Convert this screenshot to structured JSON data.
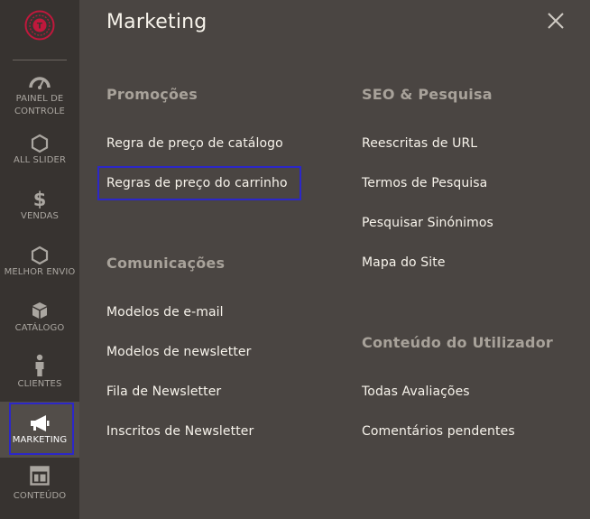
{
  "sidebar": {
    "items": [
      {
        "label_line1": "PAINEL DE",
        "label_line2": "CONTROLE",
        "icon": "dashboard-icon"
      },
      {
        "label": "ALL SLIDER",
        "icon": "hexagon-icon"
      },
      {
        "label": "VENDAS",
        "icon": "dollar-icon"
      },
      {
        "label": "MELHOR ENVIO",
        "icon": "hexagon-icon"
      },
      {
        "label": "CATÁLOGO",
        "icon": "box-icon"
      },
      {
        "label": "CLIENTES",
        "icon": "person-icon"
      },
      {
        "label": "MARKETING",
        "icon": "megaphone-icon",
        "active": true
      },
      {
        "label": "CONTEÚDO",
        "icon": "layout-icon"
      }
    ]
  },
  "panel": {
    "title": "Marketing",
    "columns": [
      {
        "sections": [
          {
            "title": "Promoções",
            "links": [
              "Regra de preço de catálogo",
              "Regras de preço do carrinho"
            ]
          },
          {
            "title": "Comunicações",
            "links": [
              "Modelos de e-mail",
              "Modelos de newsletter",
              "Fila de Newsletter",
              "Inscritos de Newsletter"
            ]
          }
        ]
      },
      {
        "sections": [
          {
            "title": "SEO & Pesquisa",
            "links": [
              "Reescritas de URL",
              "Termos de Pesquisa",
              "Pesquisar Sinónimos",
              "Mapa do Site"
            ]
          },
          {
            "title": "Conteúdo do Utilizador",
            "links": [
              "Todas Avaliações",
              "Comentários pendentes"
            ]
          }
        ]
      }
    ]
  },
  "colors": {
    "sidebar_bg": "#373330",
    "panel_bg": "#4a4542",
    "active_bg": "#524d49",
    "highlight": "#2c27c8",
    "logo": "#e0204a"
  }
}
